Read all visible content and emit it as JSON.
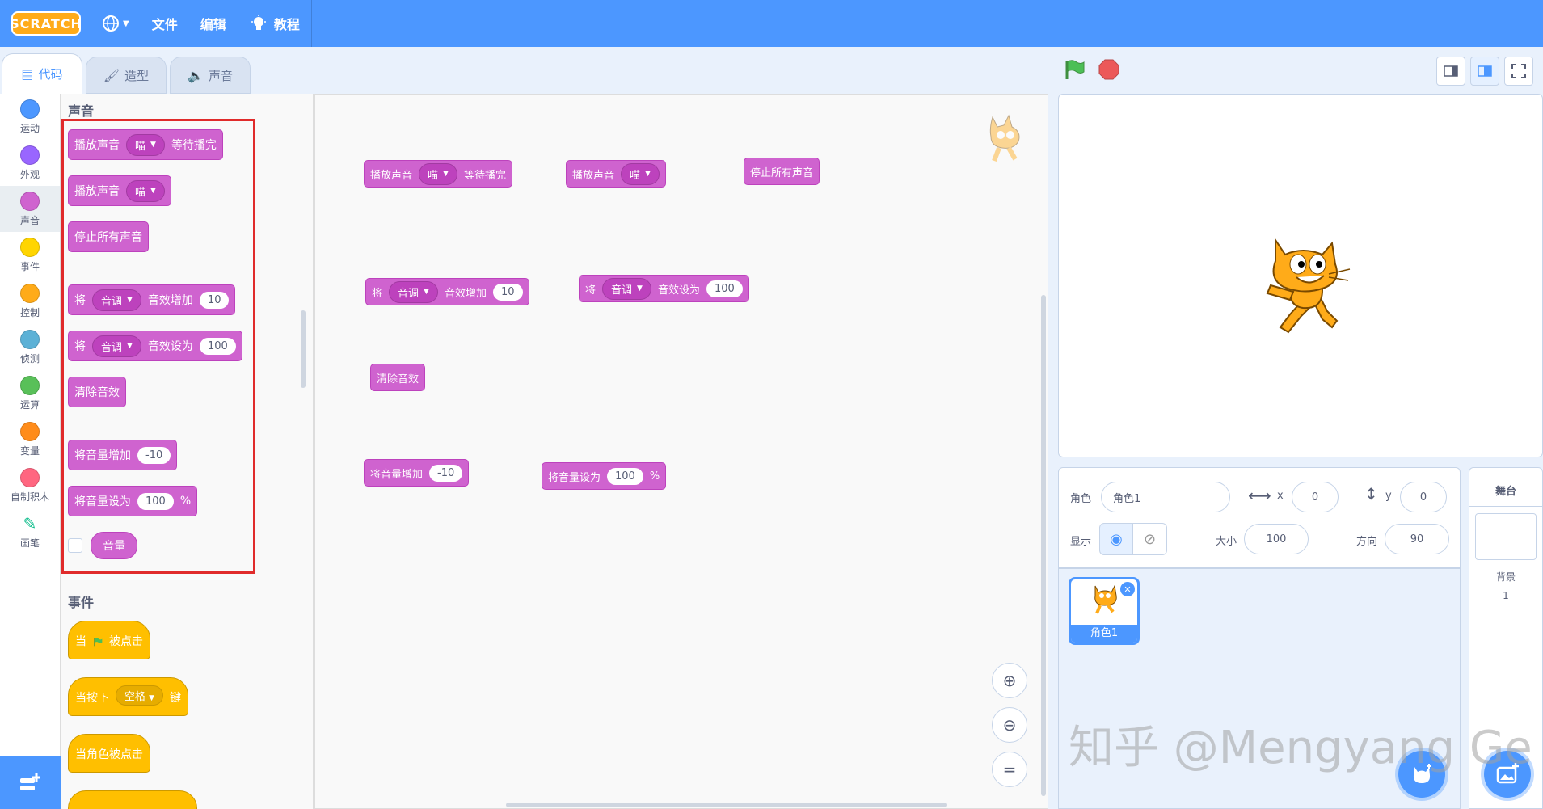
{
  "menubar": {
    "logo": "SCRATCH",
    "file": "文件",
    "edit": "编辑",
    "tutorials": "教程"
  },
  "tabs": {
    "code": "代码",
    "costumes": "造型",
    "sounds": "声音"
  },
  "categories": [
    {
      "label": "运动",
      "color": "#4c97ff"
    },
    {
      "label": "外观",
      "color": "#9966ff"
    },
    {
      "label": "声音",
      "color": "#cf63cf"
    },
    {
      "label": "事件",
      "color": "#ffd500"
    },
    {
      "label": "控制",
      "color": "#ffab19"
    },
    {
      "label": "侦测",
      "color": "#5cb1d6"
    },
    {
      "label": "运算",
      "color": "#59c059"
    },
    {
      "label": "变量",
      "color": "#ff8c1a"
    },
    {
      "label": "自制积木",
      "color": "#ff6680"
    },
    {
      "label": "画笔",
      "color": "#0fbd8c"
    }
  ],
  "palette": {
    "sound_title": "声音",
    "play_until_done": "播放声音",
    "meow": "喵",
    "until_done_suffix": "等待播完",
    "start_sound": "播放声音",
    "stop_all": "停止所有声音",
    "set_prefix": "将",
    "pitch": "音调",
    "change_effect": "音效增加",
    "set_effect": "音效设为",
    "val_10": "10",
    "val_100": "100",
    "clear_effects": "清除音效",
    "change_volume": "将音量增加",
    "val_neg10": "-10",
    "set_volume": "将音量设为",
    "percent": "%",
    "volume_reporter": "音量",
    "events_title": "事件",
    "when_flag_prefix": "当",
    "when_flag_suffix": "被点击",
    "when_key_prefix": "当按下",
    "space": "空格",
    "when_key_suffix": "键",
    "when_sprite_clicked": "当角色被点击"
  },
  "sprite_info": {
    "sprite_label": "角色",
    "sprite_name": "角色1",
    "x_label": "x",
    "x": "0",
    "y_label": "y",
    "y": "0",
    "show_label": "显示",
    "size_label": "大小",
    "size": "100",
    "direction_label": "方向",
    "direction": "90"
  },
  "sprite_list": {
    "sprite1": "角色1"
  },
  "stage_panel": {
    "title": "舞台",
    "backdrops_label": "背景",
    "backdrops_count": "1"
  },
  "watermark": "知乎 @Mengyang Ge"
}
